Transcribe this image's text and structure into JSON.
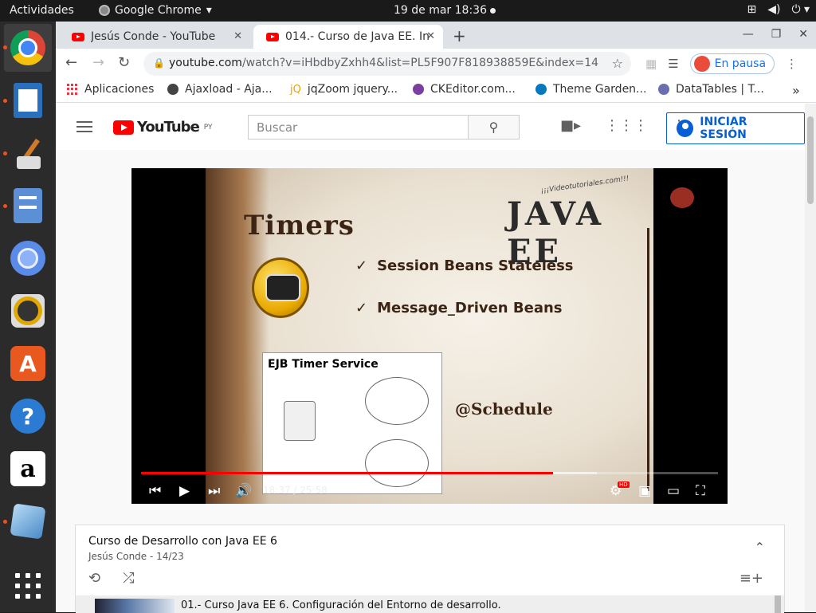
{
  "system": {
    "activities": "Actividades",
    "app_name": "Google Chrome",
    "clock": "19 de mar  18:36"
  },
  "tabs": [
    {
      "title": "Jesús Conde - YouTube",
      "active": false
    },
    {
      "title": "014.- Curso de Java EE. Int",
      "active": true
    }
  ],
  "address": {
    "url_host": "youtube.com",
    "url_rest": "/watch?v=iHbdbyZxhh4&list=PL5F907F818938859E&index=14"
  },
  "profile": {
    "label": "En pausa"
  },
  "bookmarks": [
    {
      "label": "Aplicaciones",
      "icon": "apps-grid-icon"
    },
    {
      "label": "Ajaxload - Aja...",
      "icon": "globe-icon"
    },
    {
      "label": "jqZoom jquery...",
      "icon": "jq-icon"
    },
    {
      "label": "CKEditor.com...",
      "icon": "ckeditor-icon"
    },
    {
      "label": "Theme Garden...",
      "icon": "drupal-icon"
    },
    {
      "label": "DataTables | T...",
      "icon": "datatables-icon"
    }
  ],
  "youtube": {
    "logo_text": "YouTube",
    "region": "PY",
    "search_placeholder": "Buscar",
    "signin_label": "INICIAR SESIÓN"
  },
  "video": {
    "slide_title": "Timers",
    "brand": "JAVA EE",
    "brand_sub": "¡¡¡Videotutoriales.com!!!",
    "bullets": [
      "Session Beans Stateless",
      "Message_Driven Beans"
    ],
    "diagram_title": "EJB Timer Service",
    "annotation": "@Schedule",
    "current_time": "18:37",
    "duration": "25:58",
    "time_display": "18:37 / 25:58",
    "progress_played": 0.714,
    "progress_buffered": 0.79
  },
  "playlist": {
    "title": "Curso de Desarrollo con Java EE 6",
    "author": "Jesús Conde",
    "position": "14/23",
    "first_item": "01.- Curso Java EE 6. Configuración del Entorno de desarrollo."
  },
  "colors": {
    "accent": "#e95420",
    "youtube_red": "#ff0000",
    "link_blue": "#065fd4"
  }
}
